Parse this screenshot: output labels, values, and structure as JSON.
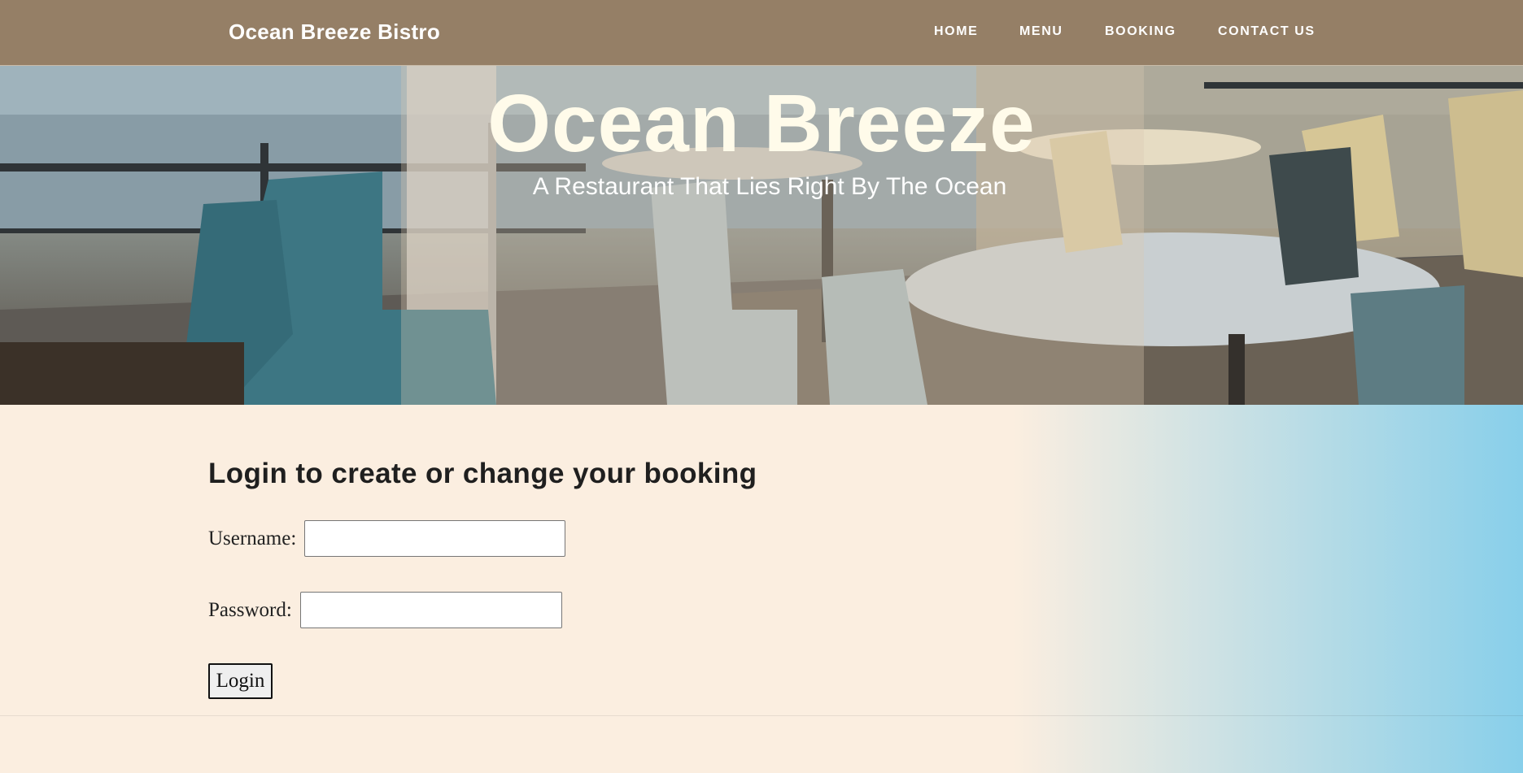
{
  "nav": {
    "brand": "Ocean Breeze Bistro",
    "links": [
      "HOME",
      "MENU",
      "BOOKING",
      "CONTACT US"
    ]
  },
  "hero": {
    "title": "Ocean Breeze",
    "subtitle": "A Restaurant That Lies Right By The Ocean",
    "image_icon": "restaurant-terrace-photo"
  },
  "login": {
    "heading": "Login to create or change your booking",
    "username_label": "Username:",
    "username_value": "",
    "password_label": "Password:",
    "password_value": "",
    "button_label": "Login"
  },
  "colors": {
    "navbar": "#957f66",
    "page_background": "#fbeee0",
    "gradient_accent": "#88cfea",
    "hero_text": "#fffbea"
  }
}
